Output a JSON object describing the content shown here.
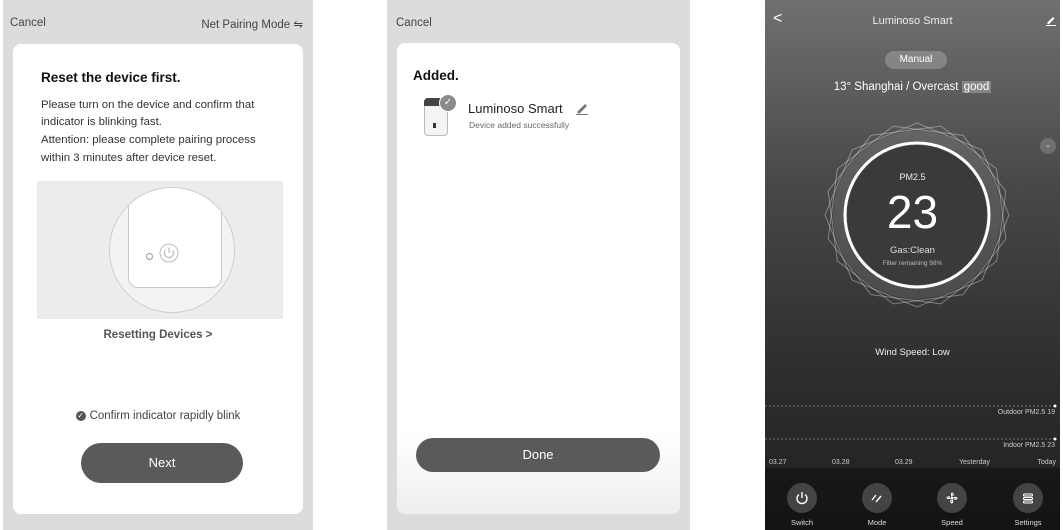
{
  "screen1": {
    "cancel_label": "Cancel",
    "mode_label": "Net Pairing Mode ⇋",
    "title": "Reset the device first.",
    "instructions": [
      "Please turn on the device and confirm that",
      "indicator is blinking fast.",
      "Attention: please complete pairing process",
      "within 3 minutes after device reset."
    ],
    "resetting_link": "Resetting Devices >",
    "confirm_label": "Confirm indicator rapidly blink",
    "next_label": "Next"
  },
  "screen2": {
    "cancel_label": "Cancel",
    "heading": "Added.",
    "device_name": "Luminoso Smart",
    "device_status": "Device added successfully",
    "done_label": "Done"
  },
  "screen3": {
    "title": "Luminoso Smart",
    "mode_pill": "Manual",
    "weather": "13° Shanghai / Overcast",
    "air_quality": "good",
    "pm_label": "PM2.5",
    "pm_value": "23",
    "gas_status": "Gas:Clean",
    "filter_status": "Filter remaining 98%",
    "wind_speed": "Wind Speed: Low",
    "outdoor_label": "Outdoor PM2.5 19",
    "indoor_label": "Indoor PM2.5 23",
    "dates": [
      "03.27",
      "03.28",
      "03.29",
      "Yesterday",
      "Today"
    ],
    "buttons": [
      {
        "label": "Switch",
        "icon": "power-icon"
      },
      {
        "label": "Mode",
        "icon": "mode-icon"
      },
      {
        "label": "Speed",
        "icon": "fan-icon"
      },
      {
        "label": "Settings",
        "icon": "settings-icon"
      }
    ]
  }
}
